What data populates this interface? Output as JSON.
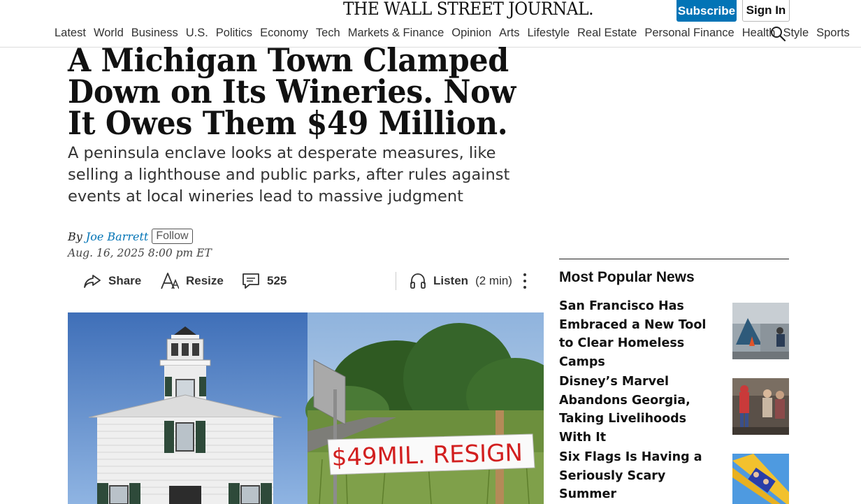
{
  "masthead": {
    "logo_text": "THE WALL STREET JOURNAL.",
    "subscribe_label": "Subscribe",
    "signin_label": "Sign In"
  },
  "nav": {
    "items": [
      "Latest",
      "World",
      "Business",
      "U.S.",
      "Politics",
      "Economy",
      "Tech",
      "Markets & Finance",
      "Opinion",
      "Arts",
      "Lifestyle",
      "Real Estate",
      "Personal Finance",
      "Health",
      "Style",
      "Sports"
    ]
  },
  "article": {
    "headline": "A Michigan Town Clamped Down on Its Wineries. Now It Owes Them $49 Million.",
    "dek": "A peninsula enclave looks at desperate measures, like selling a lighthouse and public parks, after rules against events at local wineries lead to massive judgment",
    "byline_prefix": "By",
    "author": "Joe Barrett",
    "follow_label": "Follow",
    "date": "Aug. 16, 2025 8:00 pm ET",
    "share_label": "Share",
    "resize_label": "Resize",
    "comment_count": "525",
    "listen_label": "Listen",
    "listen_duration": "(2 min)",
    "image_sign_text": "$49MIL. RESIGN"
  },
  "popular": {
    "title": "Most Popular News",
    "items": [
      {
        "title": "San Francisco Has Embraced a New Tool to Clear Homeless Camps"
      },
      {
        "title": "Disney’s Marvel Abandons Georgia, Taking Livelihoods With It"
      },
      {
        "title": "Six Flags Is Having a Seriously Scary Summer"
      }
    ]
  },
  "colors": {
    "accent": "#0274b6",
    "text": "#111111",
    "rule": "#222222"
  },
  "icons": [
    "search-icon",
    "share-icon",
    "resize-icon",
    "comment-icon",
    "headphones-icon",
    "more-vertical-icon"
  ]
}
